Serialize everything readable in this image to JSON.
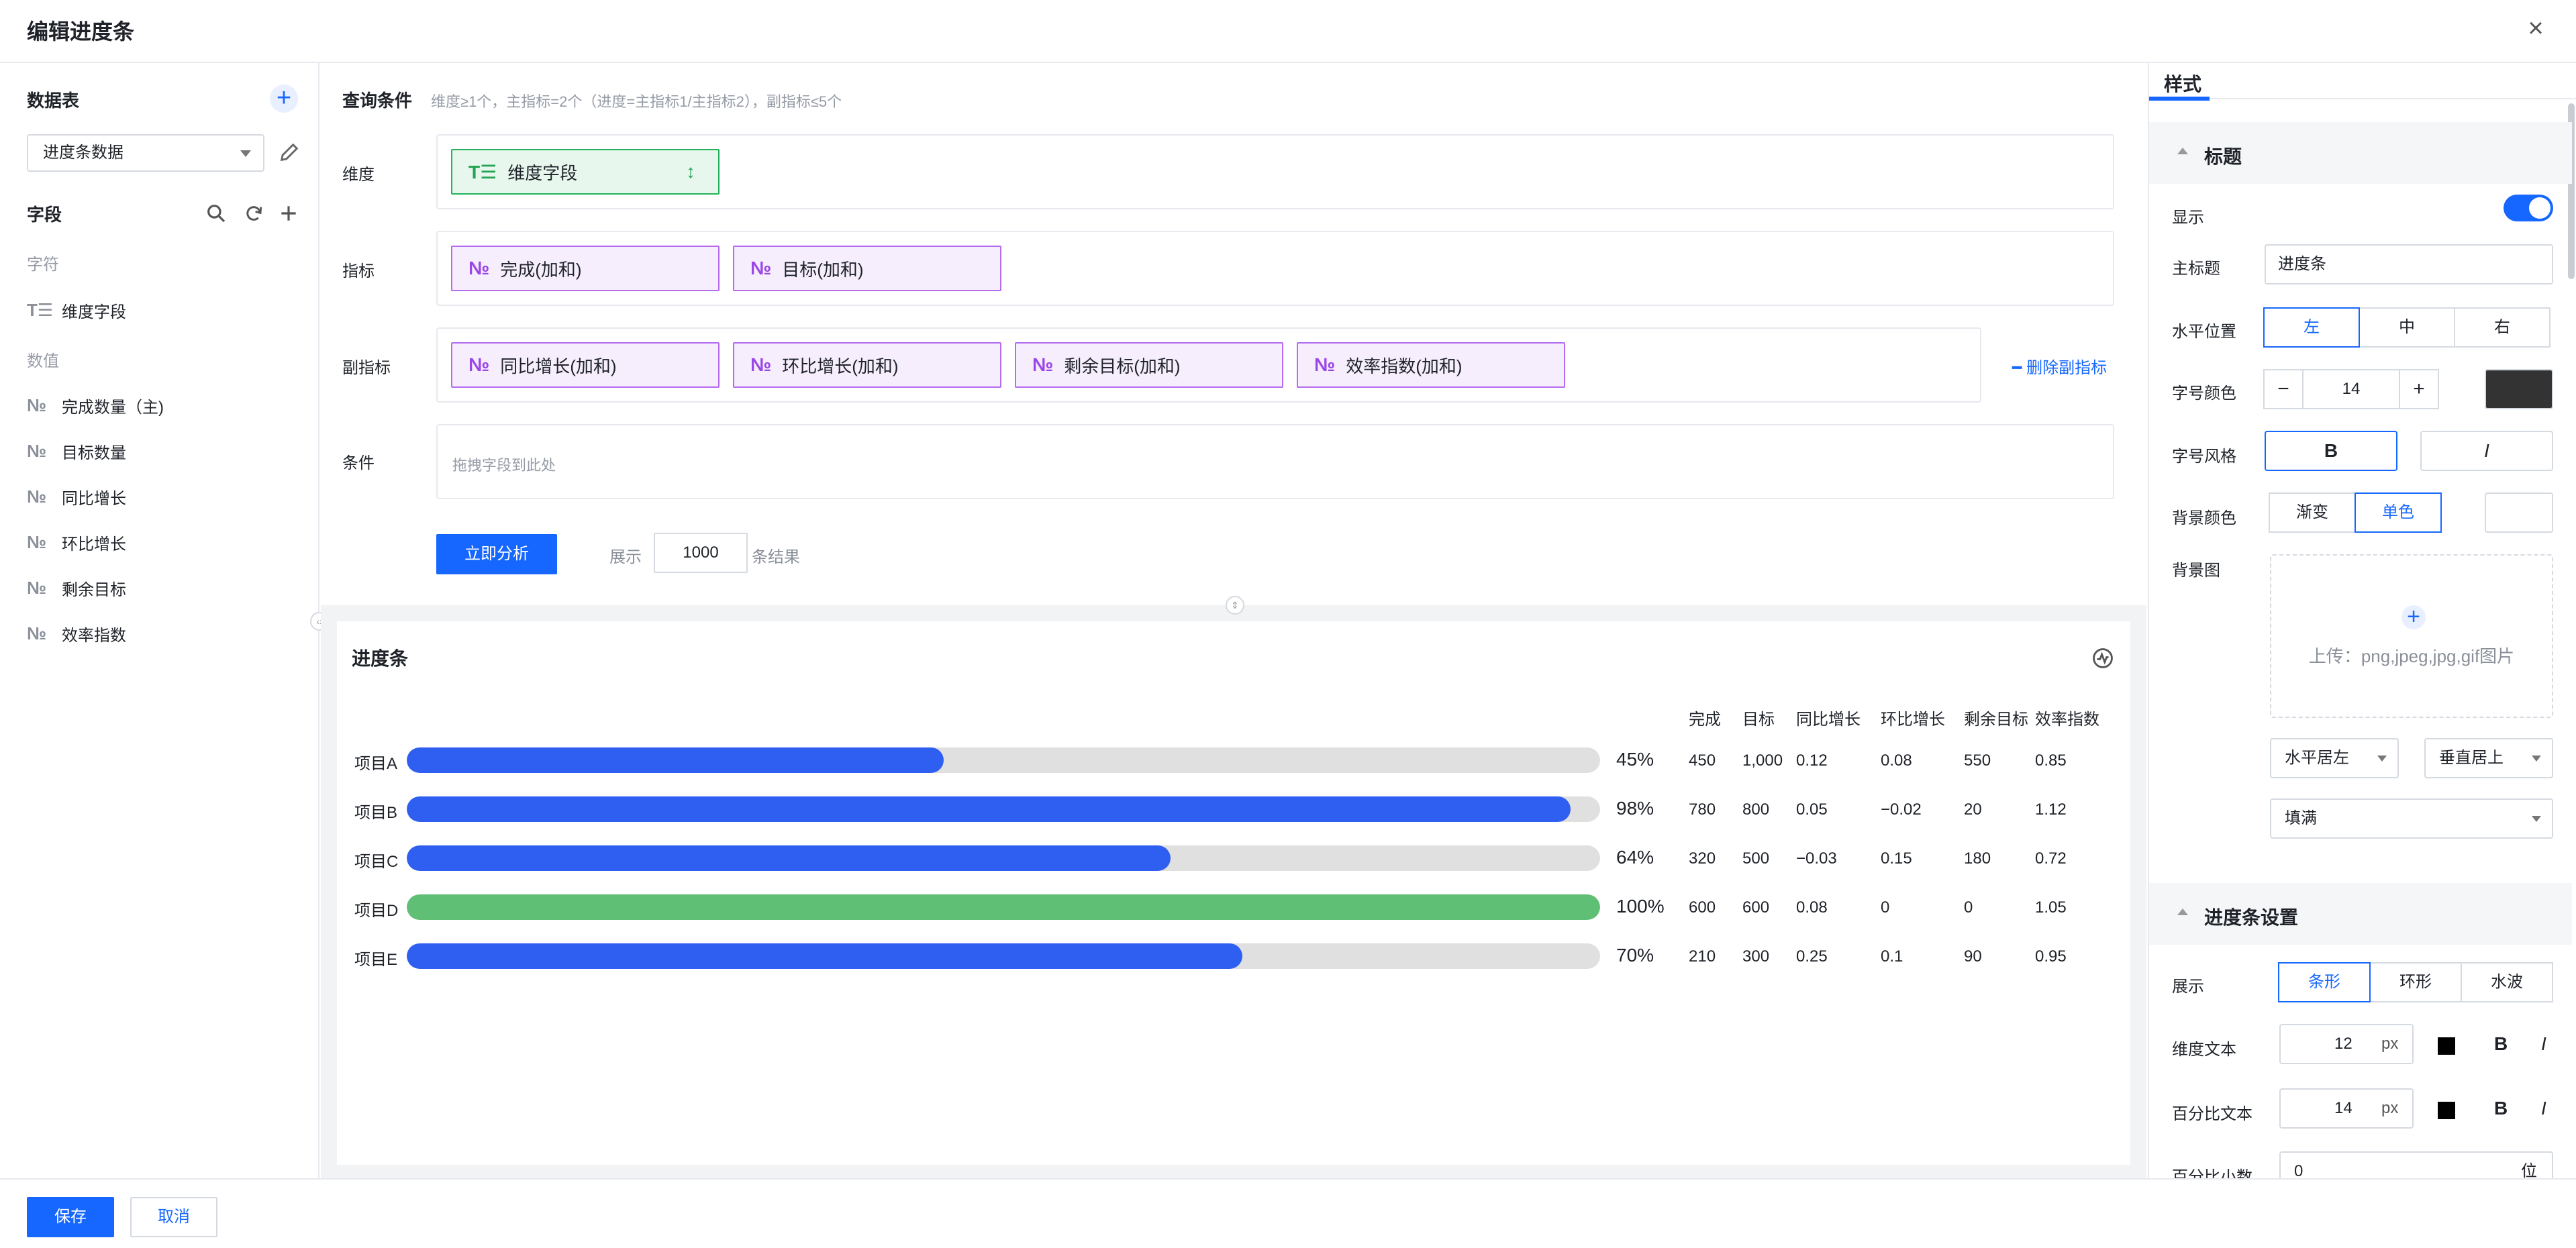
{
  "dialog": {
    "title": "编辑进度条",
    "close_icon": "×"
  },
  "sidebar": {
    "table_title": "数据表",
    "add_symbol": "+",
    "dataset": "进度条数据",
    "fields_title": "字段",
    "group_text": "字符",
    "group_number": "数值",
    "text_glyph": "T☰",
    "number_glyph": "№",
    "text_fields": [
      "维度字段"
    ],
    "number_fields": [
      "完成数量（主)",
      "目标数量",
      "同比增长",
      "环比增长",
      "剩余目标",
      "效率指数"
    ],
    "collapse_symbol": "‹›"
  },
  "query": {
    "title": "查询条件",
    "hint": "维度≥1个，主指标=2个（进度=主指标1/主指标2），副指标≤5个",
    "dimension_label": "维度",
    "measure_label": "指标",
    "sub_label": "副指标",
    "filter_label": "条件",
    "dimension_chip": "维度字段",
    "sort_glyph": "↕",
    "measure_chips": [
      "完成(加和)",
      "目标(加和)"
    ],
    "sub_chips": [
      "同比增长(加和)",
      "环比增长(加和)",
      "剩余目标(加和)",
      "效率指数(加和)"
    ],
    "delete_sub": "删除副指标",
    "filter_placeholder": "拖拽字段到此处",
    "run_button": "立即分析",
    "show_label": "展示",
    "show_count": "1000",
    "result_label": "条结果"
  },
  "chart_card": {
    "title": "进度条",
    "columns": [
      "完成",
      "目标",
      "同比增长",
      "环比增长",
      "剩余目标",
      "效率指数"
    ],
    "bar_color": "#2f5ff0",
    "complete_color": "#5fbf74",
    "track_color": "#e0e0e0"
  },
  "chart_data": {
    "type": "bar",
    "orientation": "horizontal",
    "categories": [
      "项目A",
      "项目B",
      "项目C",
      "项目D",
      "项目E"
    ],
    "percent_labels": [
      "45%",
      "98%",
      "64%",
      "100%",
      "70%"
    ],
    "progress": [
      0.45,
      0.975,
      0.64,
      1.0,
      0.7
    ],
    "xlim": [
      0,
      1
    ],
    "table": [
      [
        "450",
        "1,000",
        "0.12",
        "0.08",
        "550",
        "0.85"
      ],
      [
        "780",
        "800",
        "0.05",
        "−0.02",
        "20",
        "1.12"
      ],
      [
        "320",
        "500",
        "−0.03",
        "0.15",
        "180",
        "0.72"
      ],
      [
        "600",
        "600",
        "0.08",
        "0",
        "0",
        "1.05"
      ],
      [
        "210",
        "300",
        "0.25",
        "0.1",
        "90",
        "0.95"
      ]
    ],
    "title": "进度条"
  },
  "style_panel": {
    "tab": "样式",
    "title_section": "标题",
    "show_label": "显示",
    "main_title_label": "主标题",
    "main_title_value": "进度条",
    "hpos_label": "水平位置",
    "hpos_options": [
      "左",
      "中",
      "右"
    ],
    "font_color_label": "字号颜色",
    "minus": "−",
    "plus": "+",
    "font_size": "14",
    "font_style_label": "字号风格",
    "bold": "B",
    "italic": "I",
    "bg_color_label": "背景颜色",
    "bg_options": [
      "渐变",
      "单色"
    ],
    "bg_image_label": "背景图",
    "upload_plus": "+",
    "upload_text": "上传：png,jpeg,jpg,gif图片",
    "align_h": "水平居左",
    "align_v": "垂直居上",
    "fill_mode": "填满",
    "progress_section": "进度条设置",
    "display_label": "展示",
    "display_options": [
      "条形",
      "环形",
      "水波"
    ],
    "dim_text_label": "维度文本",
    "dim_text_size": "12",
    "unit_px": "px",
    "pct_text_label": "百分比文本",
    "pct_text_size": "14",
    "pct_decimal_label": "百分比小数",
    "pct_decimal_value": "0",
    "unit_digit": "位",
    "title_color": "#333333"
  },
  "footer": {
    "save": "保存",
    "cancel": "取消"
  }
}
